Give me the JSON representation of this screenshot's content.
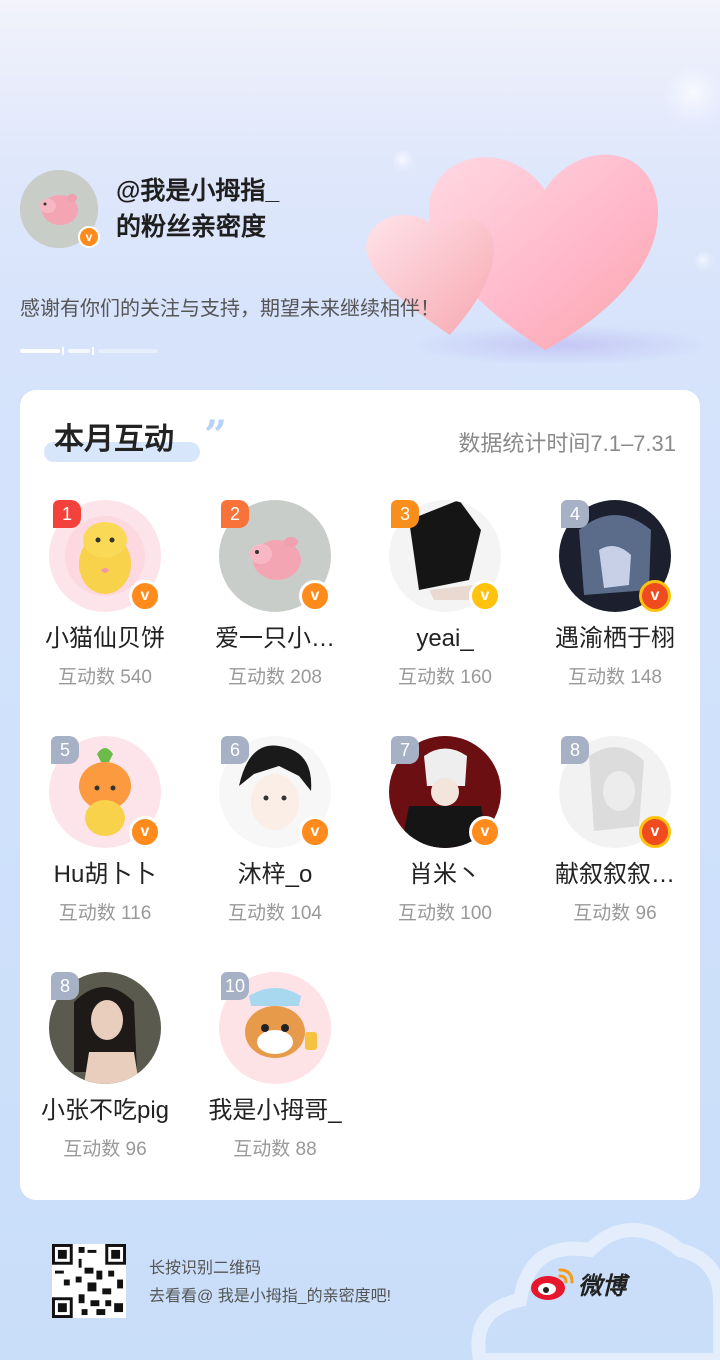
{
  "profile": {
    "handle": "@我是小拇指_",
    "subtitle": "的粉丝亲密度",
    "thanks": "感谢有你们的关注与支持，期望未来继续相伴！"
  },
  "card": {
    "title": "本月互动",
    "date_range": "数据统计时间7.1–7.31"
  },
  "fans": [
    {
      "rank": "1",
      "name": "小猫仙贝饼",
      "count": "互动数 540",
      "badge": "orange"
    },
    {
      "rank": "2",
      "name": "爱一只小…",
      "count": "互动数 208",
      "badge": "orange"
    },
    {
      "rank": "3",
      "name": "yeai_",
      "count": "互动数 160",
      "badge": "gold"
    },
    {
      "rank": "4",
      "name": "遇渝栖于栩",
      "count": "互动数 148",
      "badge": "red"
    },
    {
      "rank": "5",
      "name": "Hu胡卜卜",
      "count": "互动数 116",
      "badge": "orange"
    },
    {
      "rank": "6",
      "name": "沐梓_o",
      "count": "互动数 104",
      "badge": "orange"
    },
    {
      "rank": "7",
      "name": "肖米丶",
      "count": "互动数 100",
      "badge": "orange"
    },
    {
      "rank": "8",
      "name": "献叙叙叙…",
      "count": "互动数 96",
      "badge": "red"
    },
    {
      "rank": "8",
      "name": "小张不吃pig",
      "count": "互动数 96",
      "badge": "none"
    },
    {
      "rank": "10",
      "name": "我是小拇哥_",
      "count": "互动数 88",
      "badge": "none"
    }
  ],
  "footer": {
    "line1": "长按识别二维码",
    "line2": "去看看@ 我是小拇指_的亲密度吧!",
    "brand": "微博"
  },
  "icons": {
    "verified": "v-badge-icon",
    "qr": "qr-code-icon",
    "brand_logo": "weibo-logo-icon"
  },
  "colors": {
    "rank1": "#f2423b",
    "rank2": "#f7733a",
    "rank3": "#f88f1c",
    "rank_other": "#a7b1c6",
    "badge_orange": "#ff8b1c",
    "badge_gold": "#ffc20e",
    "badge_red": "#f04a1f"
  }
}
